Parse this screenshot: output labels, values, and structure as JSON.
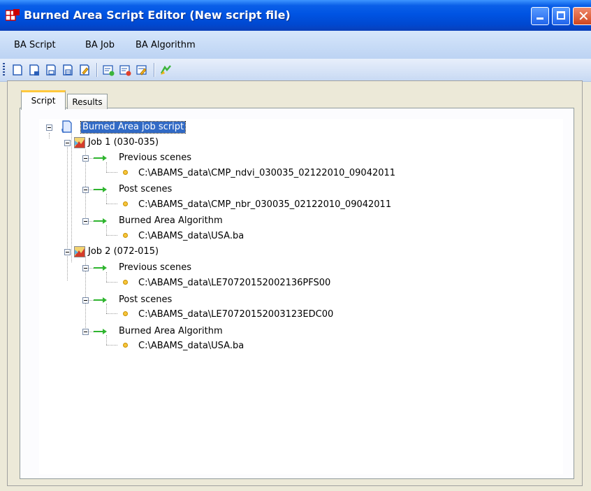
{
  "window": {
    "title": "Burned Area Script Editor (New script file)"
  },
  "menu": {
    "items": [
      {
        "label": "BA Script"
      },
      {
        "label": "BA Job"
      },
      {
        "label": "BA Algorithm"
      }
    ]
  },
  "toolbar": {
    "buttons": [
      {
        "icon": "new-script-icon"
      },
      {
        "icon": "open-script-icon"
      },
      {
        "icon": "save-script-icon"
      },
      {
        "icon": "save-as-icon"
      },
      {
        "icon": "edit-script-icon"
      },
      {
        "icon": "add-job-icon"
      },
      {
        "icon": "remove-job-icon"
      },
      {
        "icon": "edit-job-icon"
      },
      {
        "icon": "run-icon"
      }
    ]
  },
  "tabs": [
    {
      "label": "Script",
      "active": true
    },
    {
      "label": "Results",
      "active": false
    }
  ],
  "tree": {
    "root": "Burned Area job script",
    "jobs": [
      {
        "label": "Job 1 (030-035)",
        "groups": [
          {
            "label": "Previous scenes",
            "item": "C:\\ABAMS_data\\CMP_ndvi_030035_02122010_09042011"
          },
          {
            "label": "Post scenes",
            "item": "C:\\ABAMS_data\\CMP_nbr_030035_02122010_09042011"
          },
          {
            "label": "Burned Area Algorithm",
            "item": "C:\\ABAMS_data\\USA.ba"
          }
        ]
      },
      {
        "label": "Job 2 (072-015)",
        "groups": [
          {
            "label": "Previous scenes",
            "item": "C:\\ABAMS_data\\LE70720152002136PFS00"
          },
          {
            "label": "Post scenes",
            "item": "C:\\ABAMS_data\\LE70720152003123EDC00"
          },
          {
            "label": "Burned Area Algorithm",
            "item": "C:\\ABAMS_data\\USA.ba"
          }
        ]
      }
    ]
  },
  "colors": {
    "titlebar": "#0054e3",
    "selection": "#316ac5",
    "arrow": "#2fb52f",
    "dot": "#f7c53a"
  }
}
